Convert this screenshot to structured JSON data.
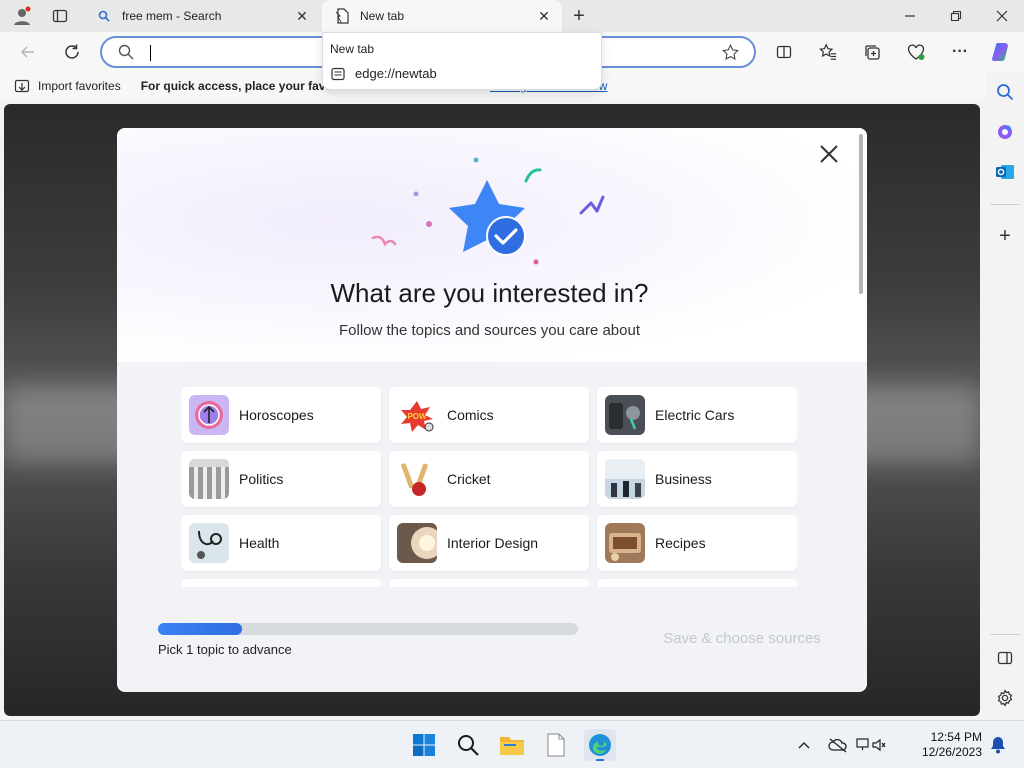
{
  "tabs": [
    {
      "title": "free mem - Search",
      "icon": "search-icon"
    },
    {
      "title": "New tab",
      "icon": "newtab-icon"
    }
  ],
  "address_bar": {
    "value": "",
    "placeholder": ""
  },
  "dropdown": {
    "title": "New tab",
    "url": "edge://newtab"
  },
  "favorites_bar": {
    "import_label": "Import favorites",
    "hint_text": "For quick access, place your favor",
    "link_text": "Manage favorites now"
  },
  "modal": {
    "title": "What are you interested in?",
    "subtitle": "Follow the topics and sources you care about",
    "topics": [
      {
        "label": "Horoscopes",
        "icon": "horoscope-thumb"
      },
      {
        "label": "Comics",
        "icon": "comics-thumb"
      },
      {
        "label": "Electric Cars",
        "icon": "electric-car-thumb"
      },
      {
        "label": "Politics",
        "icon": "politics-thumb"
      },
      {
        "label": "Cricket",
        "icon": "cricket-thumb"
      },
      {
        "label": "Business",
        "icon": "business-thumb"
      },
      {
        "label": "Health",
        "icon": "health-thumb"
      },
      {
        "label": "Interior Design",
        "icon": "interior-design-thumb"
      },
      {
        "label": "Recipes",
        "icon": "recipes-thumb"
      }
    ],
    "progress_fraction": 0.2,
    "progress_label": "Pick 1 topic to advance",
    "save_label": "Save & choose sources"
  },
  "taskbar": {
    "time": "12:54 PM",
    "date": "12/26/2023"
  },
  "colors": {
    "accent": "#3b82f6",
    "address_border": "#6b8fd6",
    "modal_bg": "#f1f3f6"
  }
}
